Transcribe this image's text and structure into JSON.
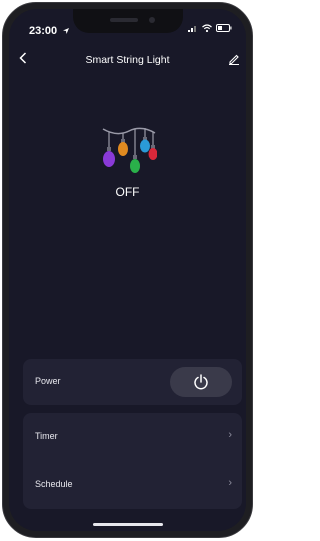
{
  "status_bar": {
    "time": "23:00"
  },
  "header": {
    "title": "Smart String Light"
  },
  "device": {
    "state": "OFF"
  },
  "power": {
    "label": "Power"
  },
  "menu": [
    {
      "label": "Timer"
    },
    {
      "label": "Schedule"
    }
  ],
  "colors": {
    "background": "#181828",
    "card": "#222234",
    "power_button": "#3a3a4a"
  },
  "icons": [
    "back-icon",
    "edit-icon",
    "power-icon",
    "chevron-right-icon",
    "wifi-icon",
    "signal-icon",
    "battery-icon",
    "location-icon"
  ]
}
